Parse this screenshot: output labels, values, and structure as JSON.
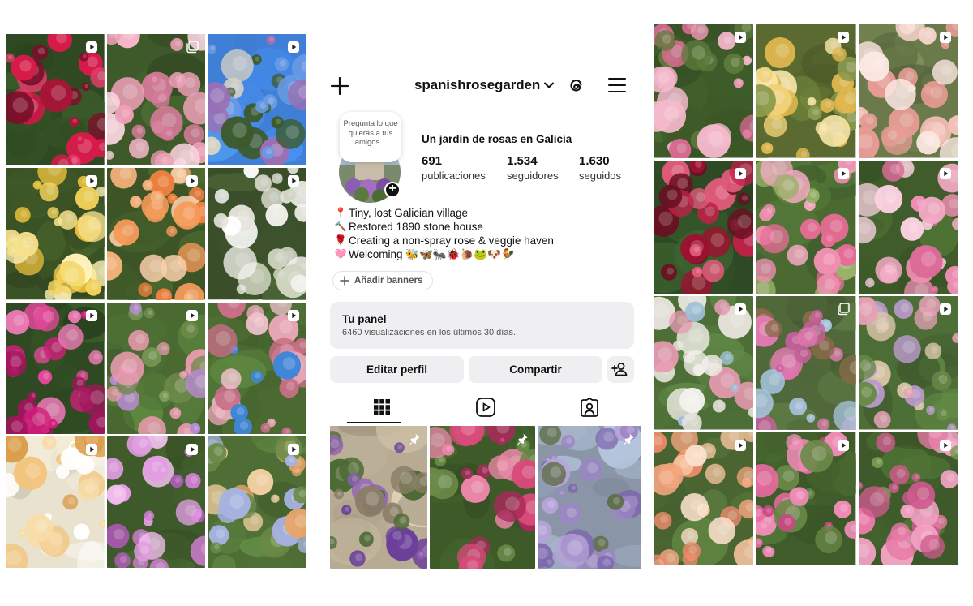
{
  "profile": {
    "username": "spanishrosegarden",
    "note": "Pregunta lo que quieras a tus amigos...",
    "name": "Un jardín de rosas en Galicia",
    "stats": [
      {
        "value": "691",
        "label": "publicaciones"
      },
      {
        "value": "1.534",
        "label": "seguidores"
      },
      {
        "value": "1.630",
        "label": "seguidos"
      }
    ],
    "bio": [
      {
        "icon": "pin-icon",
        "glyph": "📍",
        "text": "Tiny, lost Galician village"
      },
      {
        "icon": "hammer-icon",
        "glyph": "🔨",
        "text": "Restored 1890 stone house"
      },
      {
        "icon": "rose-icon",
        "glyph": "🌹",
        "text": "Creating a non-spray rose & veggie haven"
      },
      {
        "icon": "heart-icon",
        "glyph": "🩷",
        "text": "Welcoming 🐝🦋🐜🐞🐌🐸🐶🐓"
      }
    ],
    "banner_button": "Añadir banners",
    "panel": {
      "title": "Tu panel",
      "subtitle": "6460 visualizaciones en los últimos 30 días."
    },
    "actions": {
      "edit": "Editar perfil",
      "share": "Compartir"
    },
    "tabs": [
      "grid-icon",
      "reels-icon",
      "tagged-icon"
    ]
  },
  "colors": {
    "button_bg": "#efeff1",
    "text": "#111111",
    "muted": "#555555"
  },
  "left_grid": [
    {
      "scene": "crimson-roses",
      "badge": "reel-icon"
    },
    {
      "scene": "pink-roses",
      "badge": "carousel-icon"
    },
    {
      "scene": "butterfly-sky",
      "badge": "reel-icon"
    },
    {
      "scene": "yellow-roses",
      "badge": "reel-icon"
    },
    {
      "scene": "apricot-roses",
      "badge": "reel-icon"
    },
    {
      "scene": "white-roses",
      "badge": "reel-icon"
    },
    {
      "scene": "magenta-roses",
      "badge": "reel-icon"
    },
    {
      "scene": "garden-border",
      "badge": "reel-icon"
    },
    {
      "scene": "rose-arch",
      "badge": "reel-icon"
    },
    {
      "scene": "peach-roses",
      "badge": "reel-icon"
    },
    {
      "scene": "pink-stocks",
      "badge": "reel-icon"
    },
    {
      "scene": "mixed-border",
      "badge": "reel-icon"
    }
  ],
  "right_grid": [
    {
      "scene": "pink-climber",
      "badge": "reel-icon"
    },
    {
      "scene": "yellow-climber",
      "badge": "reel-icon"
    },
    {
      "scene": "blush-roses",
      "badge": "reel-icon"
    },
    {
      "scene": "red-bush",
      "badge": "reel-icon"
    },
    {
      "scene": "foxgloves",
      "badge": "reel-icon"
    },
    {
      "scene": "pink-bush",
      "badge": "reel-icon"
    },
    {
      "scene": "white-arch",
      "badge": "reel-icon"
    },
    {
      "scene": "garden-arbor",
      "badge": "carousel-icon"
    },
    {
      "scene": "path-arches",
      "badge": "reel-icon"
    },
    {
      "scene": "peach-climber",
      "badge": "reel-icon"
    },
    {
      "scene": "pink-hedge",
      "badge": "reel-icon"
    },
    {
      "scene": "rose-wall",
      "badge": "reel-icon"
    }
  ],
  "pinned_posts": [
    {
      "scene": "stone-house",
      "badge": "pin-icon"
    },
    {
      "scene": "rose-garden",
      "badge": "pin-icon"
    },
    {
      "scene": "wisteria",
      "badge": "pin-icon"
    }
  ]
}
